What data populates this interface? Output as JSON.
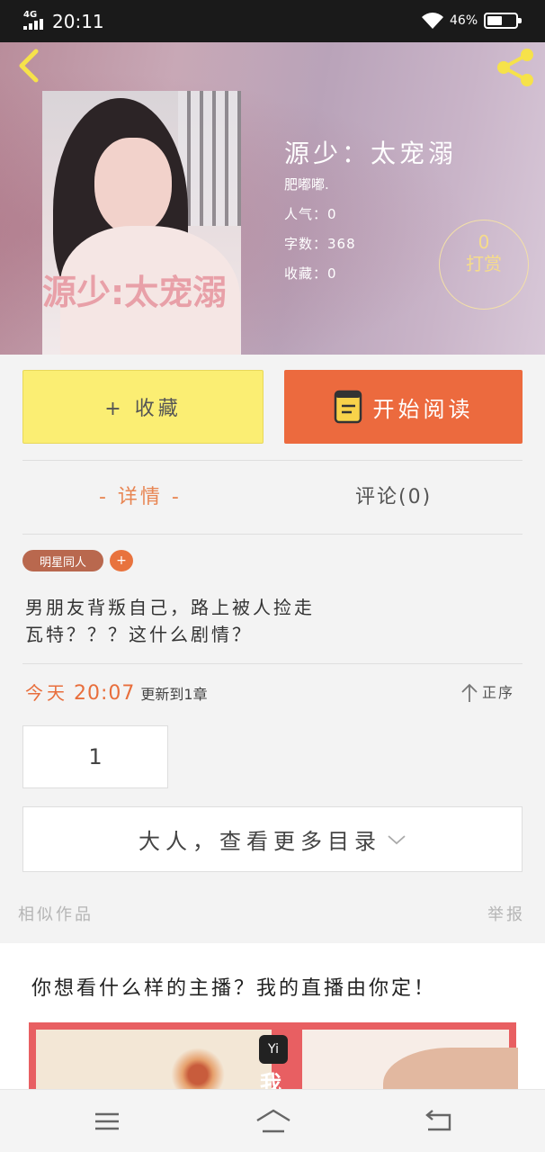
{
  "status_bar": {
    "network": "4G",
    "time": "20:11",
    "battery": "46%"
  },
  "book": {
    "title": "源少：太宠溺",
    "cover_text": "源少:太宠溺",
    "author": "肥嘟嘟.",
    "popularity": "人气：0",
    "word_count": "字数：368",
    "favorites": "收藏：0"
  },
  "tip": {
    "count": "0",
    "label": "打赏"
  },
  "actions": {
    "collect_label": "+ 收藏",
    "read_label": "开始阅读"
  },
  "tabs": {
    "details": "- 详情 -",
    "comments": "评论(0)"
  },
  "tags": {
    "category": "明星同人",
    "add": "+"
  },
  "description": {
    "line1": "男朋友背叛自己，路上被人捡走",
    "line2": "瓦特？？？这什么剧情？"
  },
  "update": {
    "day": "今天",
    "time": "20:07",
    "text": "更新到1章"
  },
  "sort": {
    "label": "正序"
  },
  "chapters": {
    "first": "1",
    "more": "大人，查看更多目录"
  },
  "similar": {
    "label": "相似作品",
    "report": "举报"
  },
  "promo": {
    "text": "你想看什么样的主播？我的直播由你定！",
    "logo": "Yi",
    "char": "我"
  },
  "colors": {
    "accent": "#ec6a3e",
    "collect": "#fbee73",
    "tip": "#f6dc8a"
  },
  "icons": [
    "back-icon",
    "share-icon",
    "book-icon",
    "up-arrow-icon",
    "chevron-down-icon",
    "menu-icon",
    "home-icon",
    "back-nav-icon"
  ]
}
